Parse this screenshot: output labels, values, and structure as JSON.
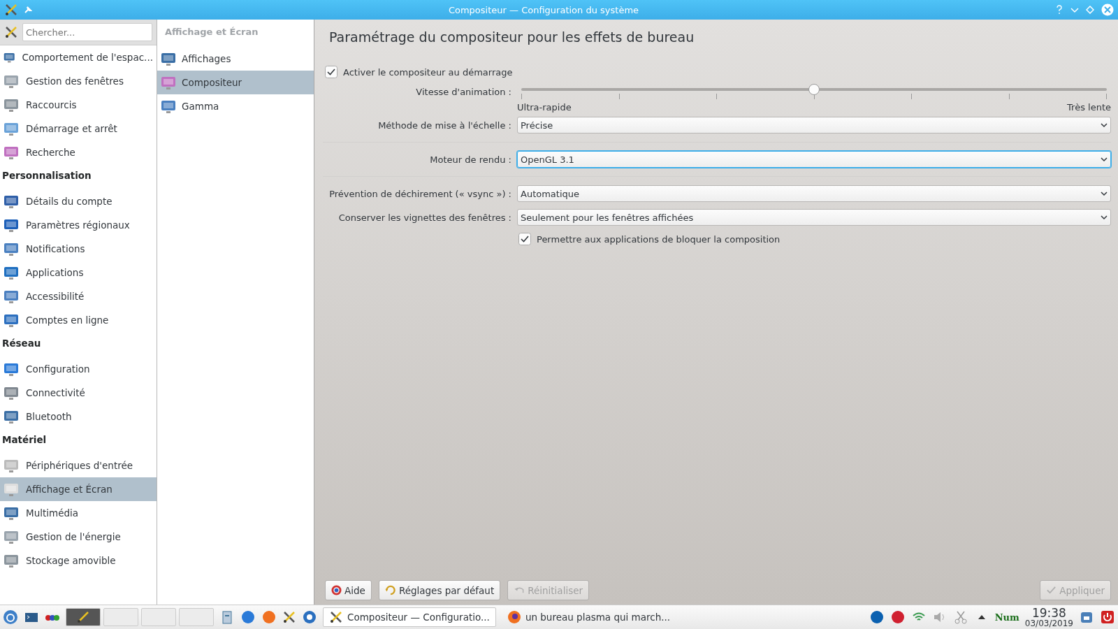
{
  "window": {
    "title": "Compositeur — Configuration du système"
  },
  "sidebar": {
    "search": {
      "placeholder": "Chercher..."
    },
    "items": [
      {
        "kind": "item",
        "label": "Comportement de l'espac...",
        "selected": false
      },
      {
        "kind": "item",
        "label": "Gestion des fenêtres",
        "selected": false
      },
      {
        "kind": "item",
        "label": "Raccourcis",
        "selected": false
      },
      {
        "kind": "item",
        "label": "Démarrage et arrêt",
        "selected": false
      },
      {
        "kind": "item",
        "label": "Recherche",
        "selected": false
      },
      {
        "kind": "header",
        "label": "Personnalisation"
      },
      {
        "kind": "item",
        "label": "Détails du compte",
        "selected": false
      },
      {
        "kind": "item",
        "label": "Paramètres régionaux",
        "selected": false
      },
      {
        "kind": "item",
        "label": "Notifications",
        "selected": false
      },
      {
        "kind": "item",
        "label": "Applications",
        "selected": false
      },
      {
        "kind": "item",
        "label": "Accessibilité",
        "selected": false
      },
      {
        "kind": "item",
        "label": "Comptes en ligne",
        "selected": false
      },
      {
        "kind": "header",
        "label": "Réseau"
      },
      {
        "kind": "item",
        "label": "Configuration",
        "selected": false
      },
      {
        "kind": "item",
        "label": "Connectivité",
        "selected": false
      },
      {
        "kind": "item",
        "label": "Bluetooth",
        "selected": false
      },
      {
        "kind": "header",
        "label": "Matériel"
      },
      {
        "kind": "item",
        "label": "Périphériques d'entrée",
        "selected": false
      },
      {
        "kind": "item",
        "label": "Affichage et Écran",
        "selected": true
      },
      {
        "kind": "item",
        "label": "Multimédia",
        "selected": false
      },
      {
        "kind": "item",
        "label": "Gestion de l'énergie",
        "selected": false
      },
      {
        "kind": "item",
        "label": "Stockage amovible",
        "selected": false
      }
    ]
  },
  "subnav": {
    "title": "Affichage et Écran",
    "items": [
      {
        "label": "Affichages",
        "selected": false
      },
      {
        "label": "Compositeur",
        "selected": true
      },
      {
        "label": "Gamma",
        "selected": false
      }
    ]
  },
  "content": {
    "heading": "Paramétrage du compositeur pour les effets de bureau",
    "enable_checkbox": {
      "label": "Activer le compositeur au démarrage",
      "checked": true
    },
    "animation_speed": {
      "label": "Vitesse d'animation :",
      "level": 0.5,
      "min_label": "Ultra-rapide",
      "max_label": "Très lente"
    },
    "dropdowns": [
      {
        "label": "Méthode de mise à l'échelle :",
        "value": "Précise",
        "focused": false
      },
      {
        "label": "Moteur de rendu :",
        "value": "OpenGL 3.1",
        "focused": true
      },
      {
        "label": "Prévention de déchirement (« vsync ») :",
        "value": "Automatique",
        "focused": false
      },
      {
        "label": "Conserver les vignettes des fenêtres :",
        "value": "Seulement pour les fenêtres affichées",
        "focused": false
      }
    ],
    "block_checkbox": {
      "label": "Permettre aux applications de bloquer la composition",
      "checked": true
    }
  },
  "buttons": [
    {
      "label": "Aide",
      "disabled": false
    },
    {
      "label": "Réglages par défaut",
      "disabled": false
    },
    {
      "label": "Réinitialiser",
      "disabled": true
    },
    {
      "label": "Appliquer",
      "disabled": true
    }
  ],
  "taskbar": {
    "tasks": [
      {
        "label": "Compositeur — Configuratio...",
        "selected": true
      },
      {
        "label": "un bureau plasma qui march...",
        "selected": false
      }
    ],
    "num_indicator": "Num",
    "clock": {
      "time": "19:38",
      "date": "03/03/2019"
    }
  }
}
